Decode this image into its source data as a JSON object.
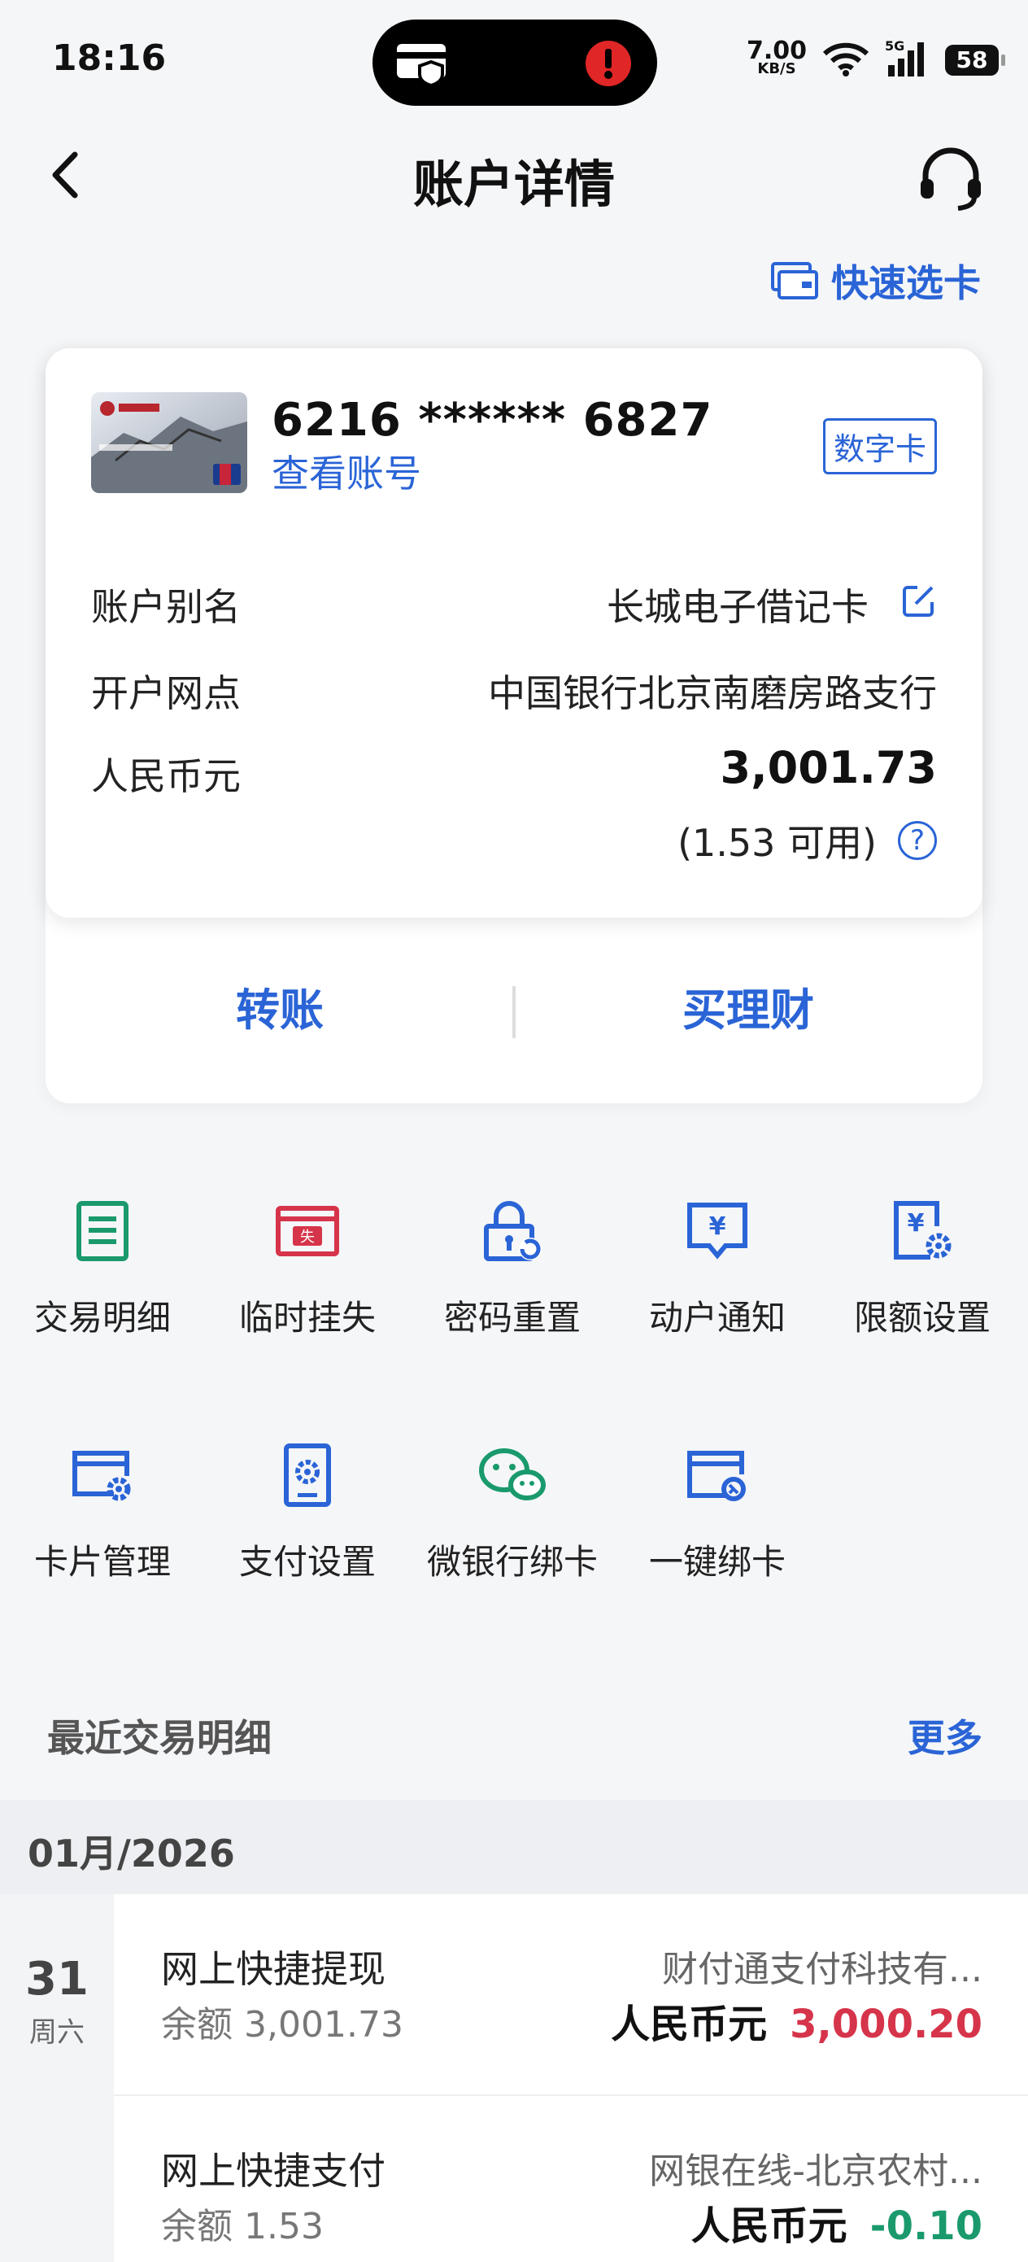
{
  "status_bar": {
    "time": "18:16",
    "net_speed": "7.00",
    "net_unit": "KB/S",
    "battery": "58",
    "icons": [
      "card-shield-icon",
      "alert-icon",
      "wifi-icon",
      "signal-5g-icon",
      "battery-icon"
    ]
  },
  "nav": {
    "title": "账户详情",
    "quick_select": "快速选卡"
  },
  "account": {
    "number": "6216 ****** 6827",
    "view_number": "查看账号",
    "badge": "数字卡",
    "alias_label": "账户别名",
    "alias_value": "长城电子借记卡",
    "branch_label": "开户网点",
    "branch_value": "中国银行北京南磨房路支行",
    "currency_label": "人民币元",
    "balance": "3,001.73",
    "available": "(1.53 可用)"
  },
  "actions": {
    "transfer": "转账",
    "buy_wealth": "买理财"
  },
  "services": [
    {
      "label": "交易明细",
      "icon": "list-icon",
      "color": "#1a9a6c"
    },
    {
      "label": "临时挂失",
      "icon": "loss-report-icon",
      "color": "#d6344a"
    },
    {
      "label": "密码重置",
      "icon": "lock-reset-icon",
      "color": "#2a64d6"
    },
    {
      "label": "动户通知",
      "icon": "notify-icon",
      "color": "#2a64d6"
    },
    {
      "label": "限额设置",
      "icon": "limit-settings-icon",
      "color": "#2a64d6"
    },
    {
      "label": "卡片管理",
      "icon": "card-manage-icon",
      "color": "#2a64d6"
    },
    {
      "label": "支付设置",
      "icon": "payment-settings-icon",
      "color": "#2a64d6"
    },
    {
      "label": "微银行绑卡",
      "icon": "wechat-icon",
      "color": "#1a9a6c"
    },
    {
      "label": "一键绑卡",
      "icon": "bind-card-icon",
      "color": "#2a64d6"
    }
  ],
  "recent": {
    "title": "最近交易明细",
    "more": "更多",
    "month": "01月/2026",
    "day": "31",
    "weekday": "周六",
    "transactions": [
      {
        "name": "网上快捷提现",
        "balance_label": "余额",
        "balance": "3,001.73",
        "counterparty": "财付通支付科技有...",
        "currency": "人民币元",
        "amount": "3,000.20",
        "amount_color": "#d6344a"
      },
      {
        "name": "网上快捷支付",
        "balance_label": "余额",
        "balance": "1.53",
        "counterparty": "网银在线-北京农村...",
        "currency": "人民币元",
        "amount": "-0.10",
        "amount_color": "#1a9a6c"
      }
    ]
  },
  "colors": {
    "accent": "#2a64d6",
    "income": "#d6344a",
    "expense": "#1a9a6c"
  }
}
